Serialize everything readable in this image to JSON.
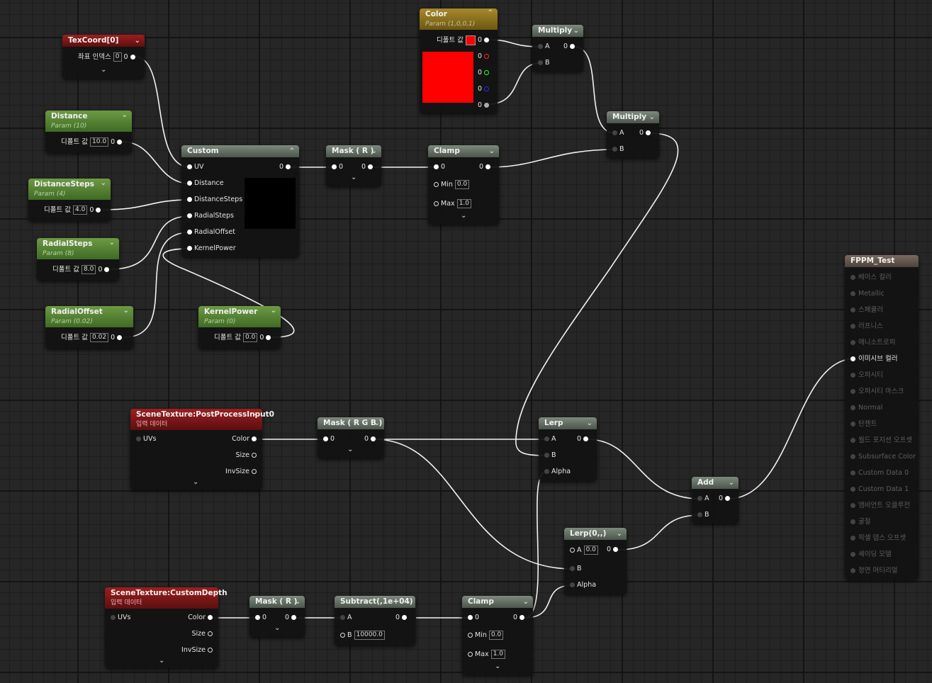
{
  "nodes": {
    "texcoord": {
      "title": "TexCoord[0]",
      "coord_label": "좌표 인덱스",
      "coord_value": "0",
      "out": "0"
    },
    "distance": {
      "title": "Distance",
      "sub": "Param (10)",
      "default_label": "디폴트 값",
      "value": "10.0",
      "out": "0"
    },
    "distancesteps": {
      "title": "DistanceSteps",
      "sub": "Param (4)",
      "default_label": "디폴트 값",
      "value": "4.0",
      "out": "0"
    },
    "radialsteps": {
      "title": "RadialSteps",
      "sub": "Param (8)",
      "default_label": "디폴트 값",
      "value": "8.0",
      "out": "0"
    },
    "radialoffset": {
      "title": "RadialOffset",
      "sub": "Param (0.02)",
      "default_label": "디폴트 값",
      "value": "0.02",
      "out": "0"
    },
    "kernelpower": {
      "title": "KernelPower",
      "sub": "Param (0)",
      "default_label": "디폴트 값",
      "value": "0.0",
      "out": "0"
    },
    "custom": {
      "title": "Custom",
      "inputs": [
        "UV",
        "Distance",
        "DistanceSteps",
        "RadialSteps",
        "RadialOffset",
        "KernelPower"
      ],
      "out": "0"
    },
    "mask_r_top": {
      "title": "Mask ( R )",
      "in": "0",
      "out": "0"
    },
    "clamp_top": {
      "title": "Clamp",
      "in": "0",
      "out": "0",
      "min_label": "Min",
      "min": "0.0",
      "max_label": "Max",
      "max": "1.0"
    },
    "color": {
      "title": "Color",
      "sub": "Param (1,0,0,1)",
      "default_label": "디폴트 값",
      "outs": [
        "0",
        "0",
        "0",
        "0",
        "0"
      ],
      "swatch": "#ff0000"
    },
    "multiply1": {
      "title": "Multiply",
      "a": "A",
      "b": "B",
      "out": "0"
    },
    "multiply2": {
      "title": "Multiply",
      "a": "A",
      "b": "B",
      "out": "0"
    },
    "scenetex_pp": {
      "title": "SceneTexture:PostProcessInput0",
      "sub": "입력 데이터",
      "uvs": "UVs",
      "outs": [
        "Color",
        "Size",
        "InvSize"
      ]
    },
    "mask_rgb": {
      "title": "Mask ( R G B )",
      "in": "0",
      "out": "0"
    },
    "lerp": {
      "title": "Lerp",
      "a": "A",
      "b": "B",
      "alpha": "Alpha",
      "out": "0"
    },
    "lerp0": {
      "title": "Lerp(0,,)",
      "a": "A",
      "a_value": "0.0",
      "b": "B",
      "alpha": "Alpha",
      "out": "0"
    },
    "add": {
      "title": "Add",
      "a": "A",
      "b": "B",
      "out": "0"
    },
    "scenetex_depth": {
      "title": "SceneTexture:CustomDepth",
      "sub": "입력 데이터",
      "uvs": "UVs",
      "outs": [
        "Color",
        "Size",
        "InvSize"
      ]
    },
    "mask_r_bottom": {
      "title": "Mask ( R )",
      "in": "0",
      "out": "0"
    },
    "subtract": {
      "title": "Subtract(,1e+04)",
      "a": "A",
      "b": "B",
      "b_value": "10000.0",
      "out": "0"
    },
    "clamp_bottom": {
      "title": "Clamp",
      "in": "0",
      "out": "0",
      "min_label": "Min",
      "min": "0.0",
      "max_label": "Max",
      "max": "1.0"
    }
  },
  "result": {
    "title": "FPPM_Test",
    "inputs": [
      "베이스 컬러",
      "Metallic",
      "스페큘러",
      "러프니스",
      "애니소트로피",
      "이미시브 컬러",
      "오파시티",
      "오파시티 마스크",
      "Normal",
      "탄젠트",
      "월드 포지션 오프셋",
      "Subsurface Color",
      "Custom Data 0",
      "Custom Data 1",
      "앰비언트 오클루전",
      "굴절",
      "픽셀 뎁스 오프셋",
      "셰이딩 모델",
      "정면 머티리얼"
    ],
    "active_index": 5
  }
}
